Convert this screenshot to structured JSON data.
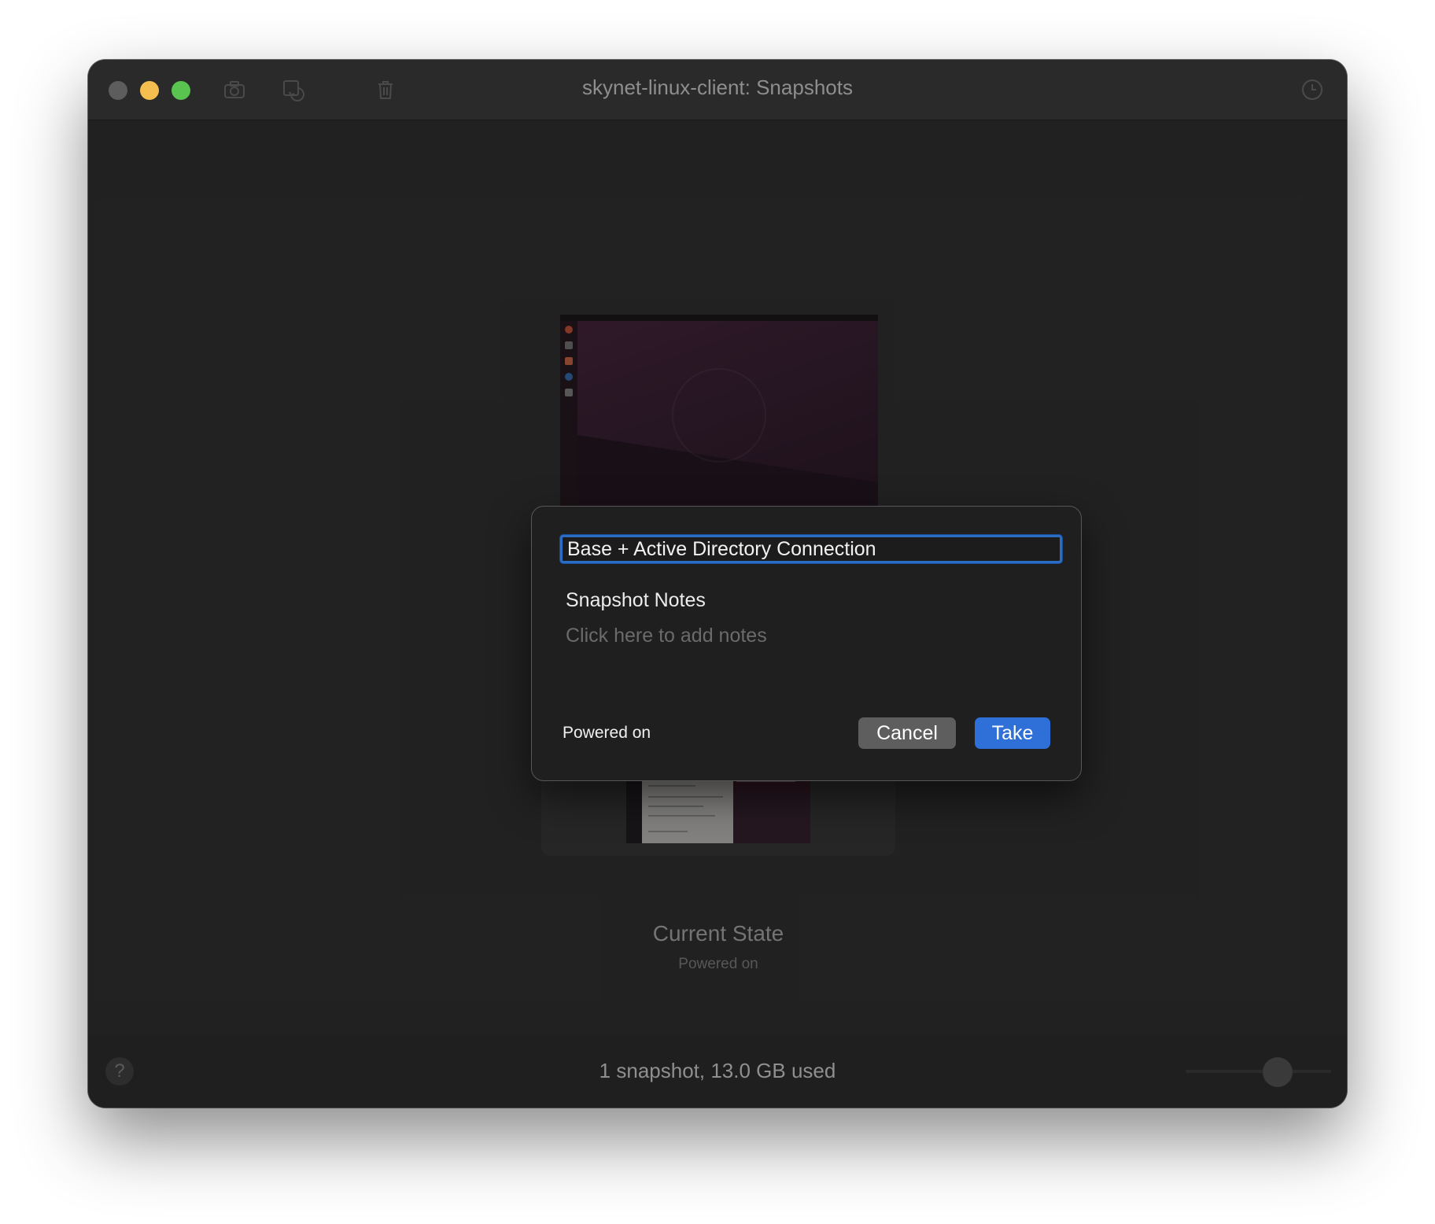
{
  "window": {
    "title": "skynet-linux-client: Snapshots"
  },
  "toolbar": {
    "icons": [
      "camera-icon",
      "restore-snapshot-icon",
      "trash-icon",
      "clock-icon"
    ]
  },
  "current_state": {
    "title": "Current State",
    "status": "Powered on"
  },
  "dialog": {
    "name_value": "Base + Active Directory Connection",
    "notes_label": "Snapshot Notes",
    "notes_placeholder": "Click here to add notes",
    "state_text": "Powered on",
    "cancel_label": "Cancel",
    "take_label": "Take"
  },
  "footer": {
    "help_label": "?",
    "summary": "1 snapshot, 13.0 GB used"
  },
  "colors": {
    "accent": "#2e6fd8",
    "close": "#5d5d5d",
    "minimize": "#f5bf4f",
    "maximize": "#5ac451"
  }
}
